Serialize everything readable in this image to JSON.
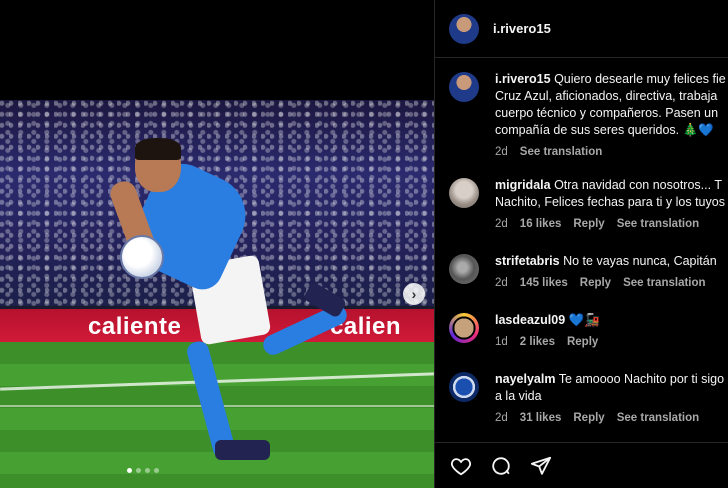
{
  "post": {
    "author": "i.rivero15",
    "ad_text_1": "caliente",
    "ad_text_2": "calien",
    "next_icon": "chevron-right-icon",
    "carousel": {
      "count": 4,
      "active": 0
    }
  },
  "comments": [
    {
      "user": "i.rivero15",
      "text_lines": [
        "Quiero desearle muy felices fie",
        "Cruz Azul, aficionados, directiva, trabaja",
        "cuerpo técnico y compañeros. Pasen un",
        "compañía de sus seres queridos. 🎄💙"
      ],
      "time": "2d",
      "likes": "",
      "reply": "",
      "translate": "See translation"
    },
    {
      "user": "migridala",
      "text_lines": [
        "Otra navidad con nosotros... T",
        "Nachito, Felices fechas para ti y los tuyos"
      ],
      "time": "2d",
      "likes": "16 likes",
      "reply": "Reply",
      "translate": "See translation"
    },
    {
      "user": "strifetabris",
      "text_lines": [
        "No te vayas nunca, Capitán"
      ],
      "time": "2d",
      "likes": "145 likes",
      "reply": "Reply",
      "translate": "See translation"
    },
    {
      "user": "lasdeazul09",
      "text_lines": [
        "💙🚂"
      ],
      "time": "1d",
      "likes": "2 likes",
      "reply": "Reply",
      "translate": ""
    },
    {
      "user": "nayelyalm",
      "text_lines": [
        "Te amoooo Nachito por ti sigo",
        "a la vida"
      ],
      "time": "2d",
      "likes": "31 likes",
      "reply": "Reply",
      "translate": "See translation"
    }
  ],
  "actions": {
    "like_icon": "heart-icon",
    "comment_icon": "comment-icon",
    "share_icon": "share-icon"
  },
  "colors": {
    "background": "#000000",
    "text": "#f5f5f5",
    "meta": "#a8a8a8",
    "divider": "#262626"
  }
}
